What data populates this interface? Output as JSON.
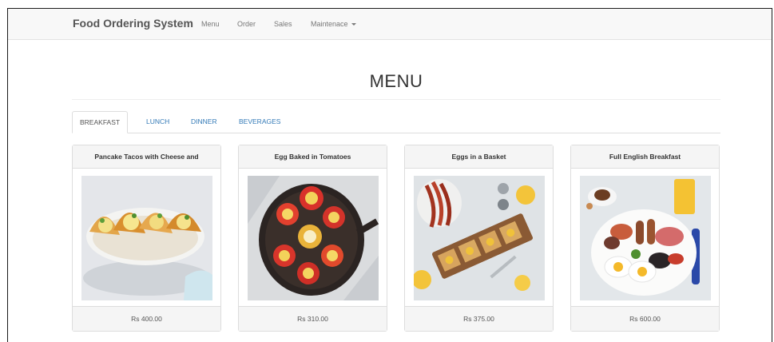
{
  "navbar": {
    "brand": "Food Ordering System",
    "links": [
      "Menu",
      "Order",
      "Sales",
      "Maintenace"
    ]
  },
  "page": {
    "title": "MENU"
  },
  "tabs": [
    "BREAKFAST",
    "LUNCH",
    "DINNER",
    "BEVERAGES"
  ],
  "active_tab": "BREAKFAST",
  "items": [
    {
      "name": "Pancake Tacos with Cheese and",
      "price": "Rs 400.00",
      "image": "pancake-tacos-photo"
    },
    {
      "name": "Egg Baked in Tomatoes",
      "price": "Rs 310.00",
      "image": "egg-baked-tomatoes-photo"
    },
    {
      "name": "Eggs in a Basket",
      "price": "Rs 375.00",
      "image": "eggs-in-basket-photo"
    },
    {
      "name": "Full English Breakfast",
      "price": "Rs 600.00",
      "image": "full-english-breakfast-photo"
    }
  ]
}
